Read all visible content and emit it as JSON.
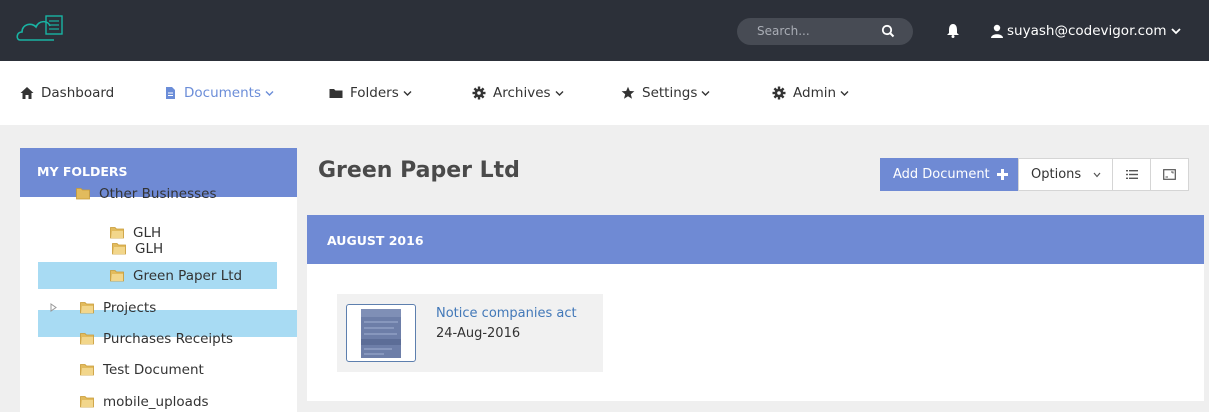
{
  "header": {
    "search_placeholder": "Search...",
    "user_email": "suyash@codevigor.com",
    "colors": {
      "bar": "#2c3039",
      "accent": "#6f8ad4"
    }
  },
  "nav": {
    "items": [
      {
        "label": "Dashboard",
        "icon": "home-icon"
      },
      {
        "label": "Documents",
        "icon": "document-icon",
        "active": true
      },
      {
        "label": "Folders",
        "icon": "folder-icon"
      },
      {
        "label": "Archives",
        "icon": "gear-icon"
      },
      {
        "label": "Settings",
        "icon": "star-icon"
      },
      {
        "label": "Admin",
        "icon": "gear-icon"
      }
    ]
  },
  "sidebar": {
    "title": "MY FOLDERS",
    "cut_off_item": "Other Businesses",
    "items": [
      {
        "label": "GLH"
      },
      {
        "label": "Green Paper Ltd",
        "selected": true
      },
      {
        "label": "Projects",
        "expandable": true
      },
      {
        "label": "Purchases Receipts"
      },
      {
        "label": "Test Document"
      },
      {
        "label": "mobile_uploads"
      }
    ]
  },
  "main": {
    "title": "Green Paper Ltd",
    "add_button": "Add Document",
    "options_button": "Options",
    "group_header": "AUGUST 2016",
    "documents": [
      {
        "name": "Notice companies act",
        "date": "24-Aug-2016"
      }
    ]
  }
}
